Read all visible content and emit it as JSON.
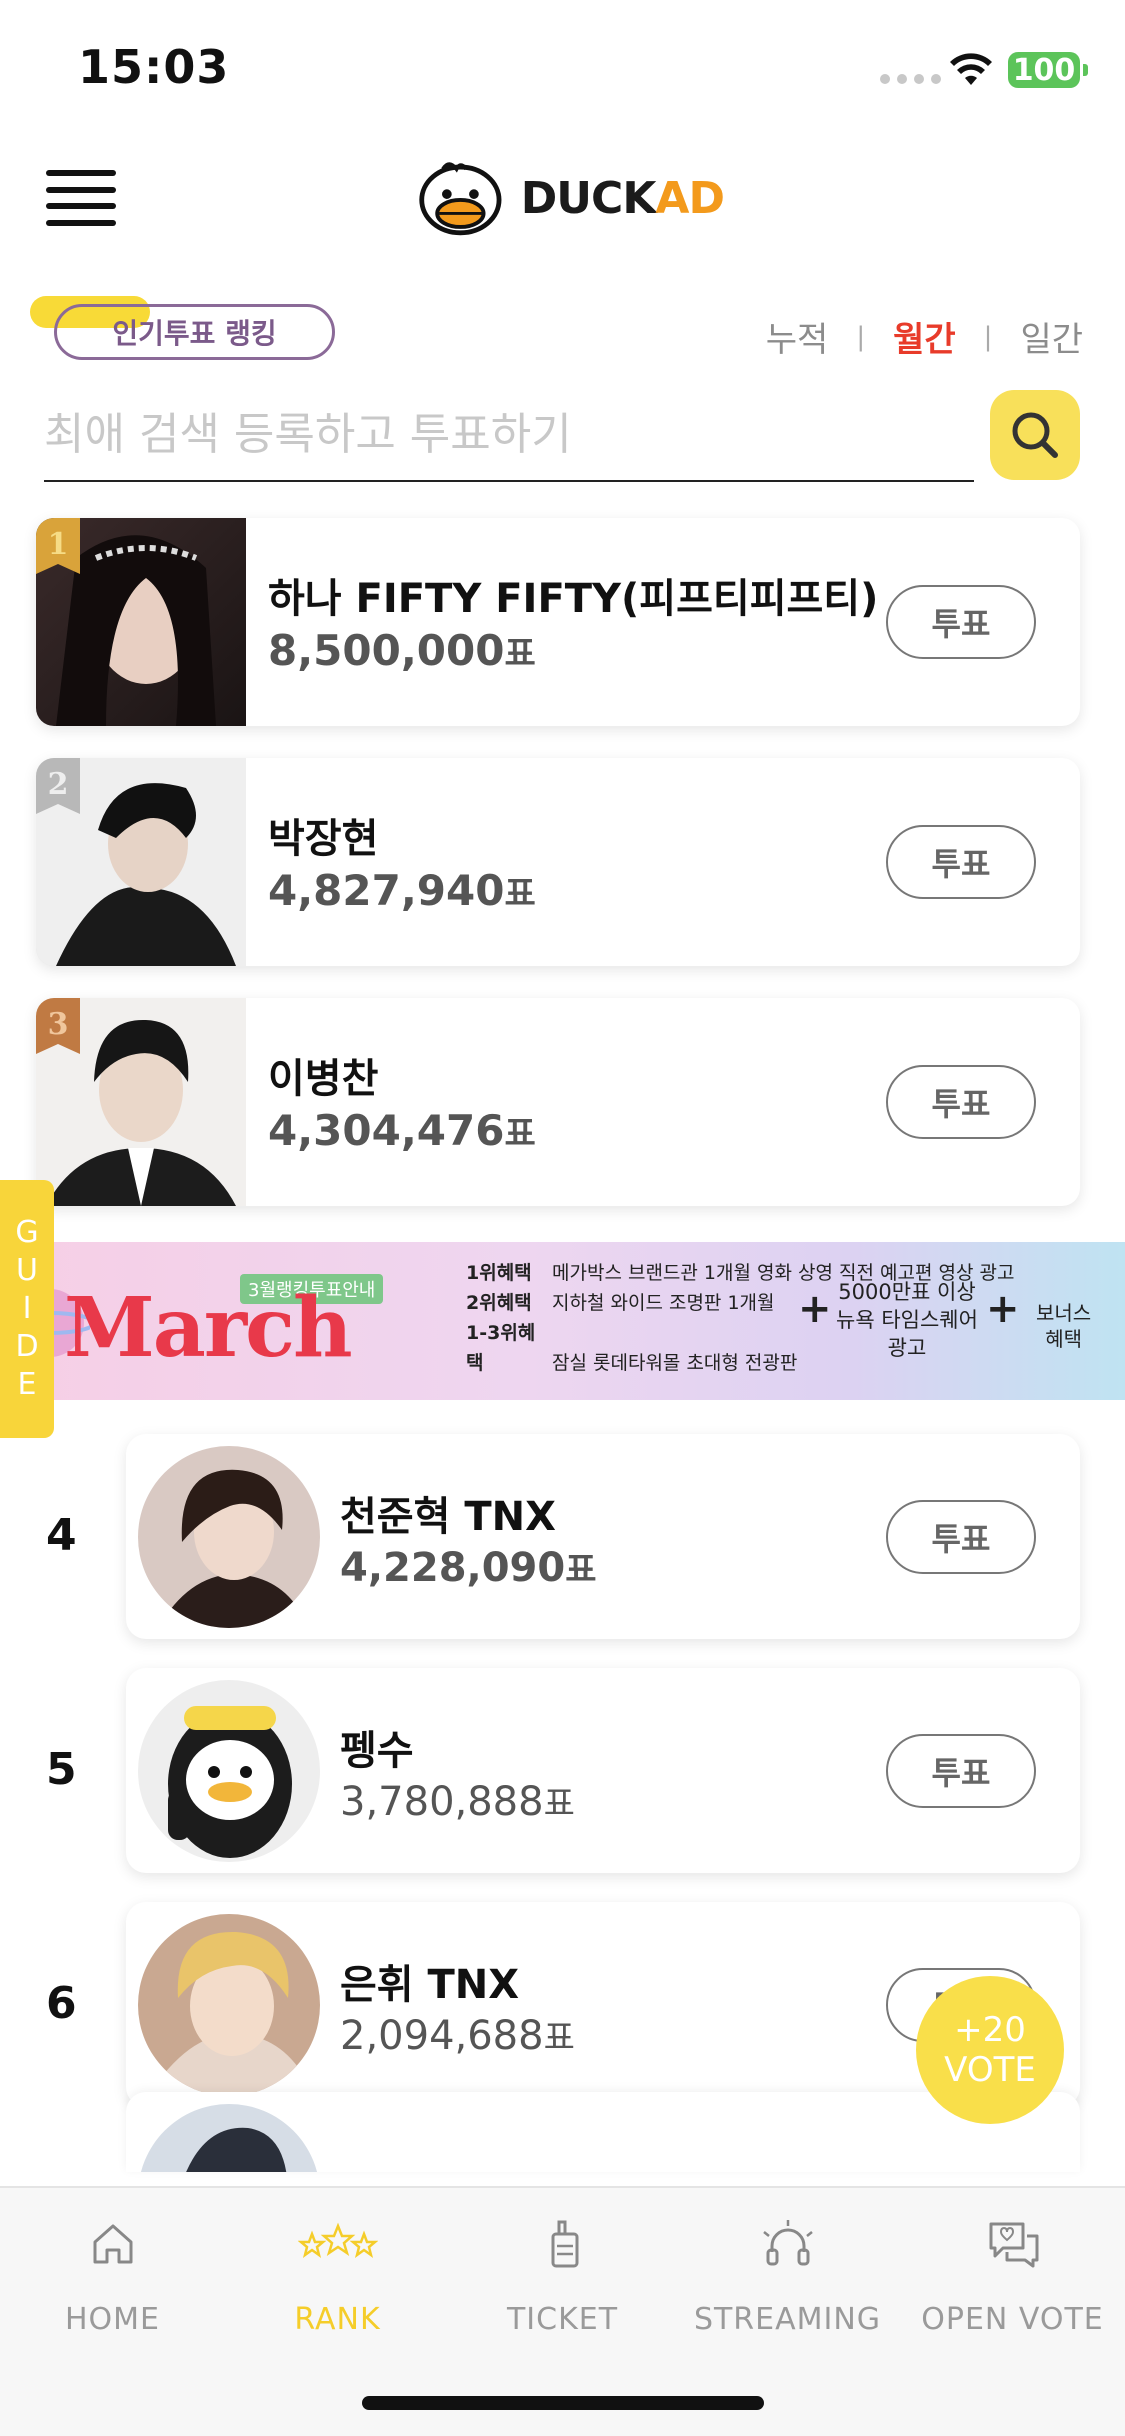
{
  "status": {
    "time": "15:03",
    "battery": "100"
  },
  "header": {
    "logo_duck": "DUCK",
    "logo_ad": "AD"
  },
  "ranking": {
    "badge": "인기투표 랭킹",
    "tabs": [
      "누적",
      "월간",
      "일간"
    ],
    "active_tab": "월간",
    "search_placeholder": "최애 검색 등록하고 투표하기"
  },
  "top3": [
    {
      "rank": "1",
      "name": "하나 FIFTY FIFTY(피프티피프티)",
      "votes": "8,500,000",
      "unit": "표",
      "button": "투표"
    },
    {
      "rank": "2",
      "name": "박장현",
      "votes": "4,827,940",
      "unit": "표",
      "button": "투표"
    },
    {
      "rank": "3",
      "name": "이병찬",
      "votes": "4,304,476",
      "unit": "표",
      "button": "투표"
    }
  ],
  "banner": {
    "tag": "3월랭킹투표안내",
    "month": "March",
    "rows": [
      {
        "label": "1위혜택",
        "text": "메가박스 브랜드관 1개월 영화 상영 직전 예고편 영상 광고"
      },
      {
        "label": "2위혜택",
        "text": "지하철 와이드 조명판 1개월"
      },
      {
        "label": "1-3위혜택",
        "text": "잠실 롯데타워몰 초대형 전광판"
      }
    ],
    "mid_lines": [
      "5000만표 이상",
      "뉴욕 타임스퀘어",
      "광고"
    ],
    "bonus_lines": [
      "보너스",
      "혜택"
    ]
  },
  "guide": [
    "G",
    "U",
    "I",
    "D",
    "E"
  ],
  "rank_list": [
    {
      "rank": "4",
      "name": "천준혁 TNX",
      "votes": "4,228,090",
      "unit": "표",
      "button": "투표"
    },
    {
      "rank": "5",
      "name": "펭수",
      "votes": "3,780,888",
      "unit": "표",
      "button": "투표"
    },
    {
      "rank": "6",
      "name": "은휘 TNX",
      "votes": "2,094,688",
      "unit": "표",
      "button": "투표"
    }
  ],
  "fab": {
    "line1": "+20",
    "line2": "VOTE"
  },
  "tabbar": [
    {
      "label": "HOME",
      "icon": "home-icon"
    },
    {
      "label": "RANK",
      "icon": "stars-icon"
    },
    {
      "label": "TICKET",
      "icon": "ticket-icon"
    },
    {
      "label": "STREAMING",
      "icon": "headphones-icon"
    },
    {
      "label": "OPEN VOTE",
      "icon": "chat-vote-icon"
    }
  ],
  "active_tab": "RANK",
  "colors": {
    "accent": "#f8da37",
    "active_period": "#e83b2a",
    "tab_active": "#f5cd2a"
  }
}
